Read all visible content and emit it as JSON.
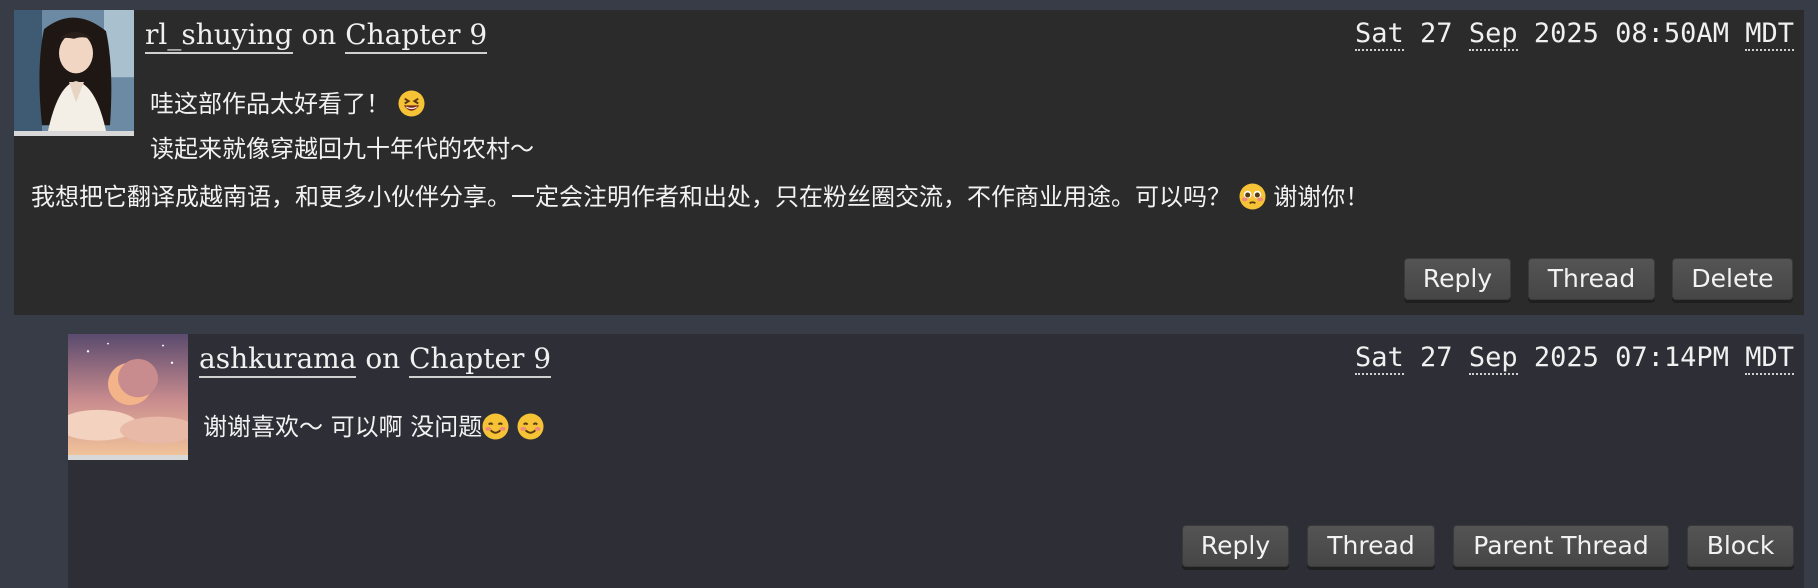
{
  "comments": [
    {
      "author": "rl_shuying",
      "on_text": "on",
      "chapter": "Chapter 9",
      "timestamp": {
        "day": "Sat",
        "date": "27",
        "month": "Sep",
        "year": "2025",
        "time": "08:50AM",
        "tz": "MDT"
      },
      "lines": [
        {
          "text": "哇这部作品太好看了！",
          "emoji": "grinning-squinting-emoji"
        },
        {
          "text": "读起来就像穿越回九十年代的农村～"
        },
        {
          "text": "我想把它翻译成越南语，和更多小伙伴分享。一定会注明作者和出处，只在粉丝圈交流，不作商业用途。可以吗？",
          "emoji": "pleading-face-emoji",
          "after": "谢谢你！"
        }
      ],
      "buttons": [
        "Reply",
        "Thread",
        "Delete"
      ]
    },
    {
      "author": "ashkurama",
      "on_text": "on",
      "chapter": "Chapter 9",
      "timestamp": {
        "day": "Sat",
        "date": "27",
        "month": "Sep",
        "year": "2025",
        "time": "07:14PM",
        "tz": "MDT"
      },
      "lines": [
        {
          "text": "谢谢喜欢～ 可以啊 没问题",
          "emoji": "smiling-face-emoji"
        }
      ],
      "buttons": [
        "Reply",
        "Thread",
        "Parent Thread",
        "Block"
      ]
    }
  ],
  "colors": {
    "page_bg": "#383c47",
    "comment_bg": "#2b2b2c",
    "reply_bg": "#2e2f36",
    "button_bg": "#4d4d4d"
  }
}
